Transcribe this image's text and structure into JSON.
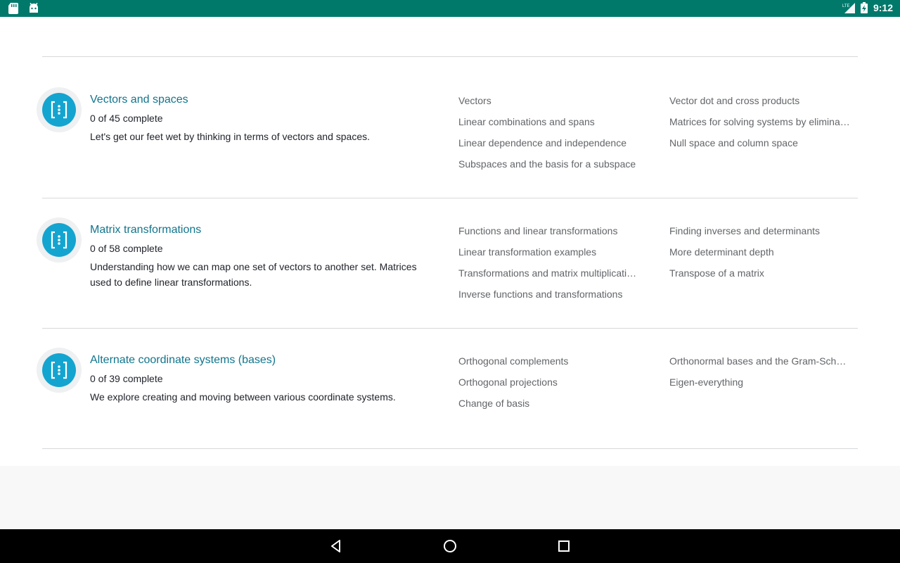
{
  "status_bar": {
    "time": "9:12",
    "network": "LTE",
    "icons": [
      "sd-card-icon",
      "android-debug-icon",
      "signal-icon",
      "battery-charging-icon"
    ]
  },
  "units": [
    {
      "title": "Vectors and spaces",
      "progress": "0 of 45 complete",
      "description": "Let's get our feet wet by thinking in terms of vectors and spaces.",
      "lessons_col1": [
        "Vectors",
        "Linear combinations and spans",
        "Linear dependence and independence",
        "Subspaces and the basis for a subspace"
      ],
      "lessons_col2": [
        "Vector dot and cross products",
        "Matrices for solving systems by elimina…",
        "Null space and column space"
      ]
    },
    {
      "title": "Matrix transformations",
      "progress": "0 of 58 complete",
      "description": "Understanding how we can map one set of vectors to another set. Matrices used to define linear transformations.",
      "lessons_col1": [
        "Functions and linear transformations",
        "Linear transformation examples",
        "Transformations and matrix multiplicati…",
        "Inverse functions and transformations"
      ],
      "lessons_col2": [
        "Finding inverses and determinants",
        "More determinant depth",
        "Transpose of a matrix"
      ]
    },
    {
      "title": "Alternate coordinate systems (bases)",
      "progress": "0 of 39 complete",
      "description": "We explore creating and moving between various coordinate systems.",
      "lessons_col1": [
        "Orthogonal complements",
        "Orthogonal projections",
        "Change of basis"
      ],
      "lessons_col2": [
        "Orthonormal bases and the Gram-Sch…",
        "Eigen-everything"
      ]
    }
  ],
  "colors": {
    "status_bar": "#00796b",
    "unit_icon": "#14a4d0",
    "unit_title": "#11758d",
    "lesson_text": "#626569"
  },
  "nav_bar": {
    "icons": [
      "back-icon",
      "home-icon",
      "recents-icon"
    ]
  }
}
